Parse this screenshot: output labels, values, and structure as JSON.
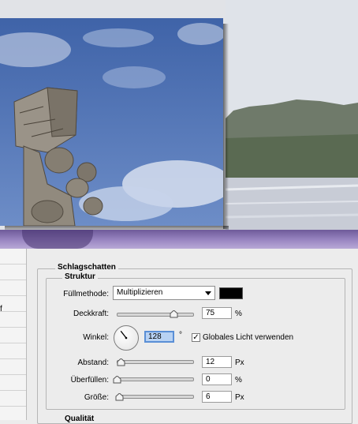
{
  "dialog": {
    "section_title": "Schlagschatten",
    "group_title": "Struktur",
    "next_group_title_partial": "Qualität",
    "left_list_stub": "f",
    "blend_mode": {
      "label": "Füllmethode:",
      "value": "Multiplizieren",
      "color": "#000000"
    },
    "opacity": {
      "label": "Deckkraft:",
      "value": "75",
      "unit": "%",
      "slider_fraction": 0.75
    },
    "angle": {
      "label": "Winkel:",
      "value": "128",
      "unit": "°",
      "global_light_checked": true,
      "global_light_label": "Globales Licht verwenden",
      "check_mark": "✓"
    },
    "distance": {
      "label": "Abstand:",
      "value": "12",
      "unit": "Px",
      "slider_fraction": 0.05
    },
    "spread": {
      "label": "Überfüllen:",
      "value": "0",
      "unit": "%",
      "slider_fraction": 0.0
    },
    "size": {
      "label": "Größe:",
      "value": "6",
      "unit": "Px",
      "slider_fraction": 0.03
    }
  },
  "colors": {
    "sky": "#4d6fae",
    "purple_strip": "#8a76b5"
  }
}
